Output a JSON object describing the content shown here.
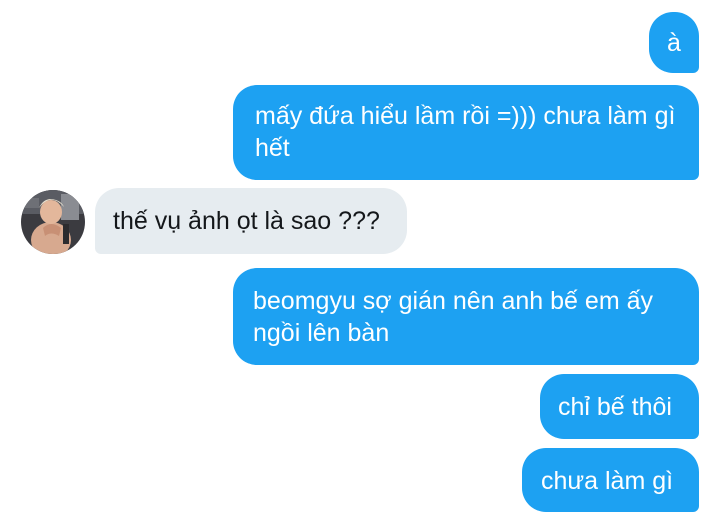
{
  "conversation": {
    "messages": [
      {
        "sender": "me",
        "text": "à"
      },
      {
        "sender": "me",
        "text": "mấy đứa hiểu lầm rồi =))) chưa làm gì hết"
      },
      {
        "sender": "them",
        "text": "thế vụ ảnh ọt là sao ???"
      },
      {
        "sender": "me",
        "text": "beomgyu sợ gián nên anh bế em ấy ngồi lên bàn"
      },
      {
        "sender": "me",
        "text": "chỉ bế thôi"
      },
      {
        "sender": "me",
        "text": "chưa làm gì"
      }
    ]
  },
  "colors": {
    "outgoing_bubble": "#1da1f2",
    "incoming_bubble": "#e6ecf0",
    "outgoing_text": "#ffffff",
    "incoming_text": "#14171a"
  },
  "icons": {
    "avatar": "user-avatar-photo"
  }
}
